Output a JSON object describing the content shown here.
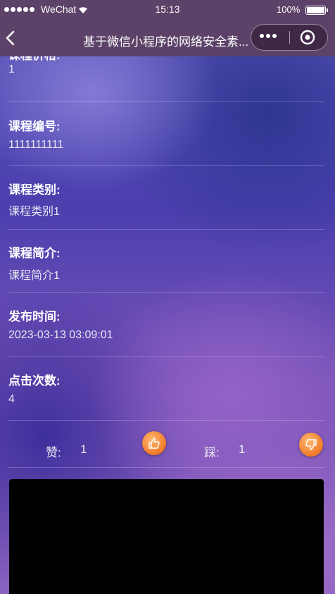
{
  "status_bar": {
    "carrier": "WeChat",
    "time": "15:13",
    "battery": "100%"
  },
  "nav": {
    "title": "基于微信小程序的网络安全素..."
  },
  "fields": [
    {
      "label": "课程价格:",
      "value": "1"
    },
    {
      "label": "课程编号:",
      "value": "1111111111"
    },
    {
      "label": "课程类别:",
      "value": "课程类别1"
    },
    {
      "label": "课程简介:",
      "value": "课程简介1"
    },
    {
      "label": "发布时间:",
      "value": "2023-03-13 03:09:01"
    },
    {
      "label": "点击次数:",
      "value": "4"
    }
  ],
  "votes": {
    "like_label": "赞:",
    "like_count": "1",
    "dislike_label": "踩:",
    "dislike_count": "1"
  },
  "icons": {
    "like": "thumbs-up-icon",
    "dislike": "thumbs-down-icon"
  },
  "colors": {
    "nav_bar": "#5c4268",
    "vote_button": "#f07a2a",
    "video_background": "#000000"
  }
}
